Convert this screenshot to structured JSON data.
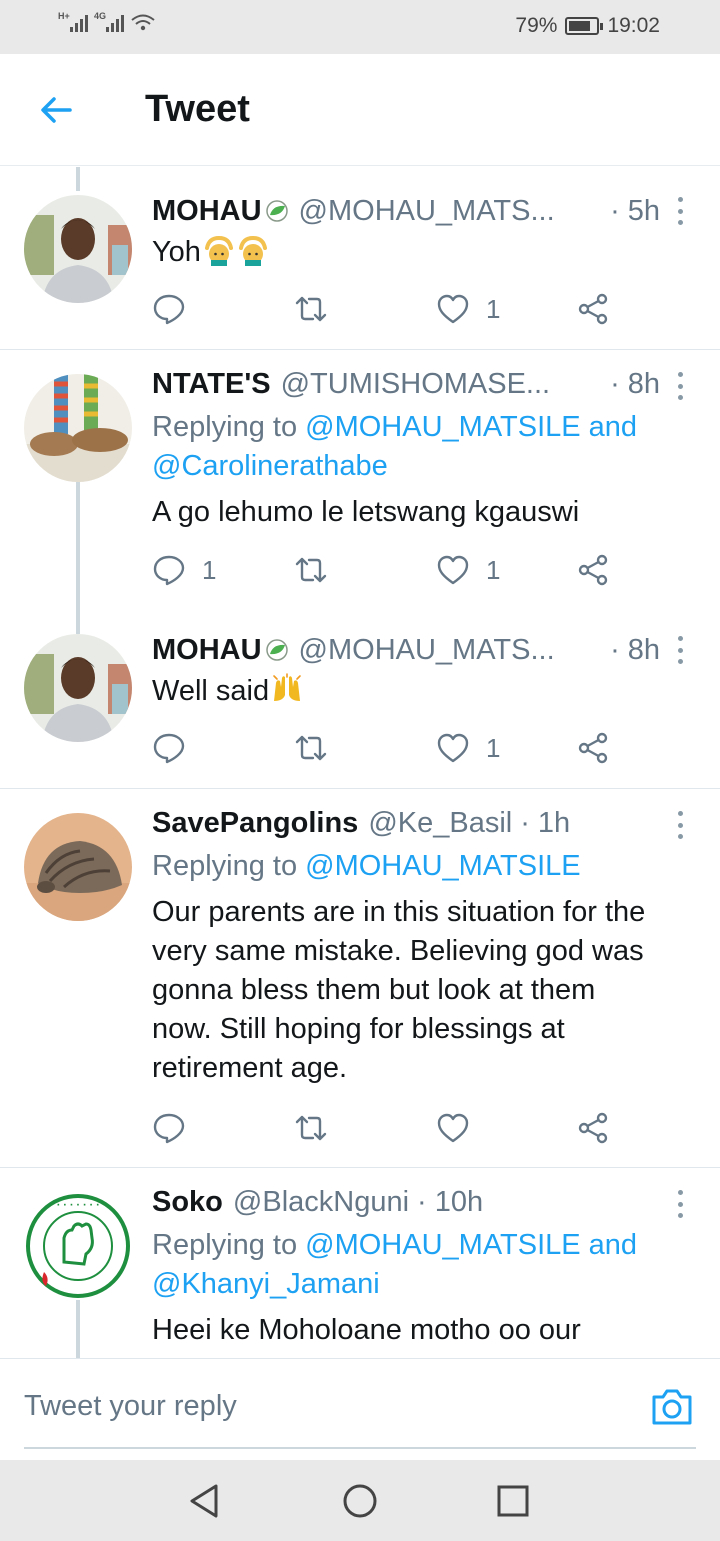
{
  "status_bar": {
    "network_1": "H+",
    "network_2": "4G",
    "battery": "79%",
    "battery_level": 0.79,
    "time": "19:02"
  },
  "header": {
    "title": "Tweet"
  },
  "tweets": [
    {
      "name": "MOHAU",
      "handle": "@MOHAU_MATS...",
      "separator": "·",
      "time": "5h",
      "text": "Yoh",
      "emoji": [
        "man-gesturing-ok",
        "man-gesturing-ok"
      ],
      "replies": "",
      "retweets": "",
      "likes": "1"
    },
    {
      "name": "NTATE'S",
      "handle": "@TUMISHOMASE...",
      "separator": "·",
      "time": "8h",
      "replying_prefix": "Replying to ",
      "replying_1": "@MOHAU_MATSILE",
      "replying_and": " and",
      "replying_2": "@Carolinerathabe",
      "text": "A go lehumo le letswang kgauswi",
      "replies": "1",
      "retweets": "",
      "likes": "1"
    },
    {
      "name": "MOHAU",
      "handle": "@MOHAU_MATS...",
      "separator": "·",
      "time": "8h",
      "text": "Well said",
      "emoji": [
        "raising-hands"
      ],
      "replies": "",
      "retweets": "",
      "likes": "1"
    },
    {
      "name": "SavePangolins",
      "handle": "@Ke_Basil",
      "separator": "·",
      "time": "1h",
      "replying_prefix": "Replying to ",
      "replying_1": "@MOHAU_MATSILE",
      "text_lines": [
        "Our parents are in this situation for the",
        "very same mistake. Believing god was",
        "gonna bless them but look at them",
        "now. Still hoping for blessings at",
        "retirement age."
      ],
      "replies": "",
      "retweets": "",
      "likes": ""
    },
    {
      "name": "Soko",
      "handle": "@BlackNguni",
      "separator": "·",
      "time": "10h",
      "replying_prefix": "Replying to ",
      "replying_1": "@MOHAU_MATSILE",
      "replying_and": " and",
      "replying_2": "@Khanyi_Jamani",
      "text": "Heei ke Moholoane motho oo our"
    }
  ],
  "reply_bar": {
    "placeholder": "Tweet your reply"
  },
  "icons": {
    "accent": "#1da1f2",
    "back": "arrow-left-icon",
    "reply": "reply-icon",
    "retweet": "retweet-icon",
    "like": "heart-icon",
    "share": "share-icon",
    "camera": "camera-icon"
  }
}
